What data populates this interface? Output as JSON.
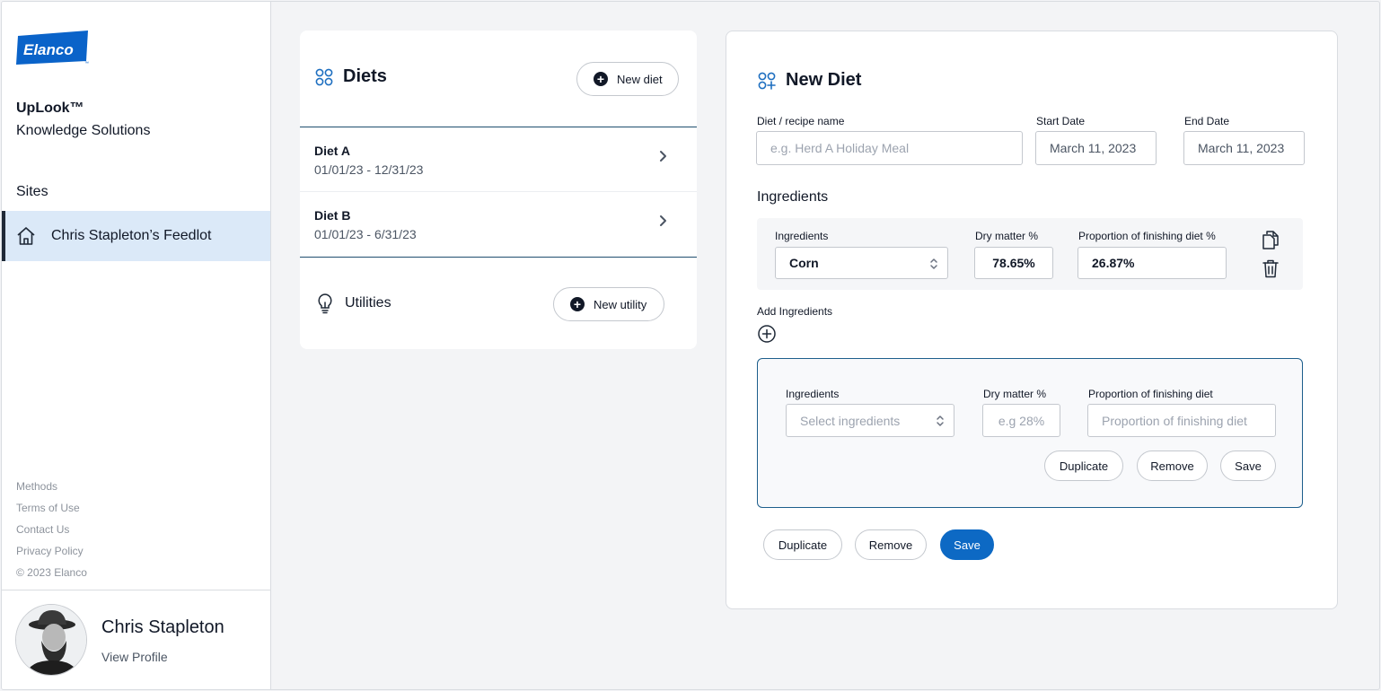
{
  "brand": {
    "logo_text": "Elanco",
    "app_name": "UpLook™",
    "app_subtitle": "Knowledge Solutions"
  },
  "sidebar": {
    "sites_label": "Sites",
    "site_item": {
      "label": "Chris Stapleton’s Feedlot",
      "icon": "home-icon"
    },
    "footer_links": [
      "Methods",
      "Terms of Use",
      "Contact Us",
      "Privacy Policy",
      "© 2023 Elanco"
    ],
    "profile": {
      "name": "Chris Stapleton",
      "link": "View Profile"
    }
  },
  "diets": {
    "title": "Diets",
    "new_button": "New diet",
    "items": [
      {
        "name": "Diet A",
        "dates": "01/01/23 - 12/31/23"
      },
      {
        "name": "Diet B",
        "dates": "01/01/23 - 6/31/23"
      }
    ],
    "utilities_title": "Utilities",
    "new_utility_button": "New utility"
  },
  "new_diet": {
    "title": "New Diet",
    "name_label": "Diet / recipe name",
    "name_placeholder": "e.g. Herd A Holiday Meal",
    "start_label": "Start Date",
    "start_value": "March 11, 2023",
    "end_label": "End Date",
    "end_value": "March 11, 2023",
    "ingredients_title": "Ingredients",
    "row": {
      "ing_label": "Ingredients",
      "ing_value": "Corn",
      "dm_label": "Dry matter %",
      "dm_value": "78.65%",
      "prop_label": "Proportion of finishing diet %",
      "prop_value": "26.87%"
    },
    "add_label": "Add Ingredients",
    "draft": {
      "ing_label": "Ingredients",
      "ing_placeholder": "Select ingredients",
      "dm_label": "Dry matter %",
      "dm_placeholder": "e.g 28%",
      "prop_label": "Proportion of finishing diet",
      "prop_placeholder": "Proportion of finishing diet",
      "duplicate": "Duplicate",
      "remove": "Remove",
      "save": "Save"
    },
    "actions": {
      "duplicate": "Duplicate",
      "remove": "Remove",
      "save": "Save"
    },
    "colors": {
      "primary": "#0d69c4",
      "accent_icon": "#1e6fc0"
    }
  }
}
